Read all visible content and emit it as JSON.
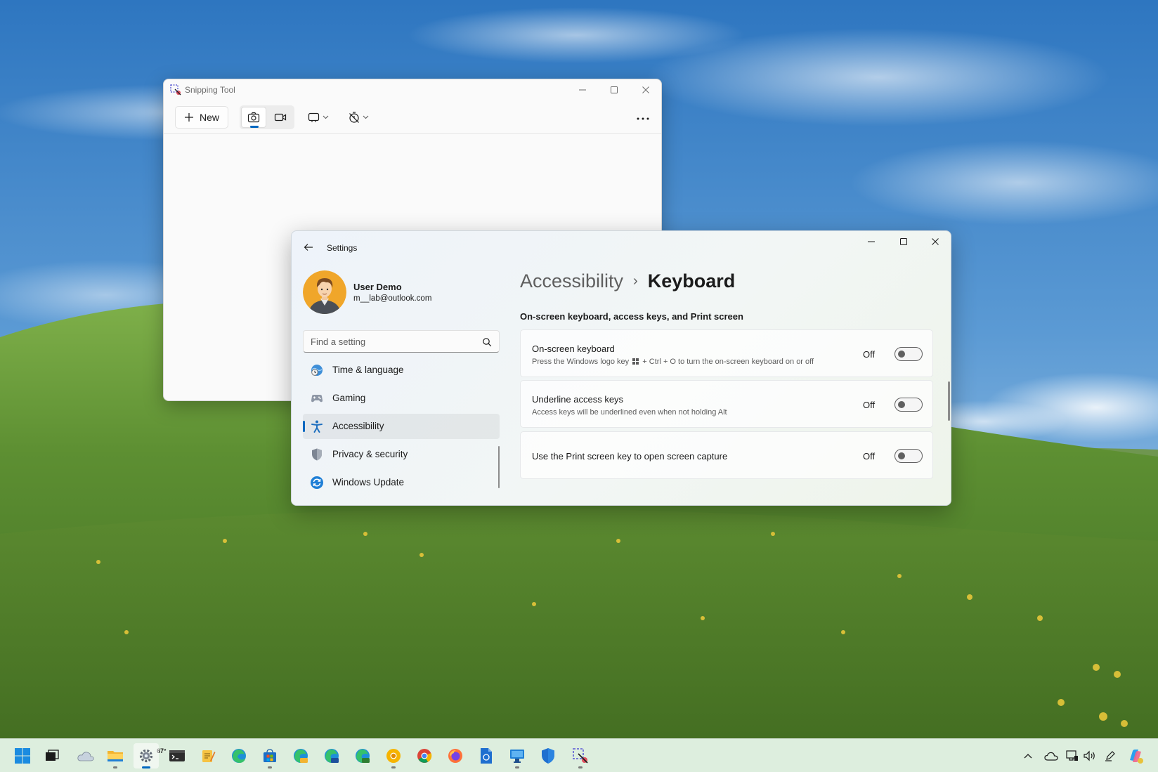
{
  "snipping_tool": {
    "title": "Snipping Tool",
    "new_label": "New"
  },
  "settings": {
    "title": "Settings",
    "user": {
      "name": "User Demo",
      "email": "m__lab@outlook.com"
    },
    "search": {
      "placeholder": "Find a setting"
    },
    "nav": [
      {
        "label": "Time & language",
        "icon": "globe-clock-icon"
      },
      {
        "label": "Gaming",
        "icon": "gamepad-icon"
      },
      {
        "label": "Accessibility",
        "icon": "accessibility-icon",
        "active": true
      },
      {
        "label": "Privacy & security",
        "icon": "shield-icon"
      },
      {
        "label": "Windows Update",
        "icon": "windows-update-icon"
      }
    ],
    "breadcrumb": {
      "parent": "Accessibility",
      "separator": "›",
      "current": "Keyboard"
    },
    "section_heading": "On-screen keyboard, access keys, and Print screen",
    "cards": [
      {
        "title": "On-screen keyboard",
        "description_before": "Press the Windows logo key",
        "description_after": "+ Ctrl + O to turn the on-screen keyboard on or off",
        "state": "Off"
      },
      {
        "title": "Underline access keys",
        "description": "Access keys will be underlined even when not holding Alt",
        "state": "Off"
      },
      {
        "title": "Use the Print screen key to open screen capture",
        "state": "Off"
      }
    ]
  },
  "taskbar": {
    "weather_temp": "67°",
    "apps": [
      "start-icon",
      "task-view-icon",
      "weather-widget-icon",
      "file-explorer-icon",
      "settings-gear-icon",
      "terminal-icon",
      "notepad-icon",
      "edge-icon",
      "microsoft-store-icon",
      "edge-canary-icon",
      "edge-beta-icon",
      "edge-dev-icon",
      "chrome-canary-icon",
      "chrome-icon",
      "firefox-icon",
      "document-icon",
      "remote-desktop-icon",
      "windows-security-icon",
      "snipping-tool-icon"
    ],
    "tray": [
      "chevron-up-icon",
      "onedrive-icon",
      "network-icon",
      "volume-icon",
      "pen-icon",
      "copilot-icon"
    ]
  },
  "colors": {
    "accent": "#0067c0",
    "taskbar": "#ddeede",
    "sky": "#3f83c6",
    "grass": "#5b8a33"
  }
}
